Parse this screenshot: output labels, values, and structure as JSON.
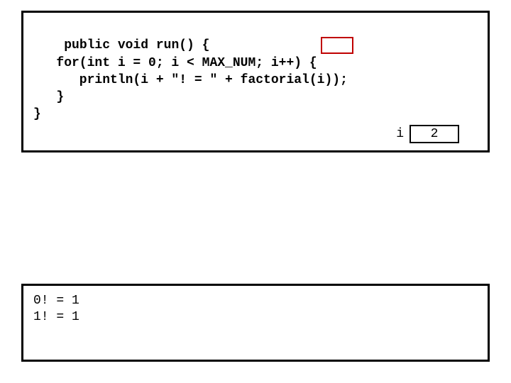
{
  "code": {
    "line1": "public void run() {",
    "line2": "   for(int i = 0; i < MAX_NUM; i++) {",
    "line3": "      println(i + \"! = \" + factorial(i));",
    "line4": "   }",
    "line5": "}"
  },
  "variable": {
    "name": "i",
    "value": "2"
  },
  "output": {
    "line1": "0! = 1",
    "line2": "1! = 1"
  }
}
